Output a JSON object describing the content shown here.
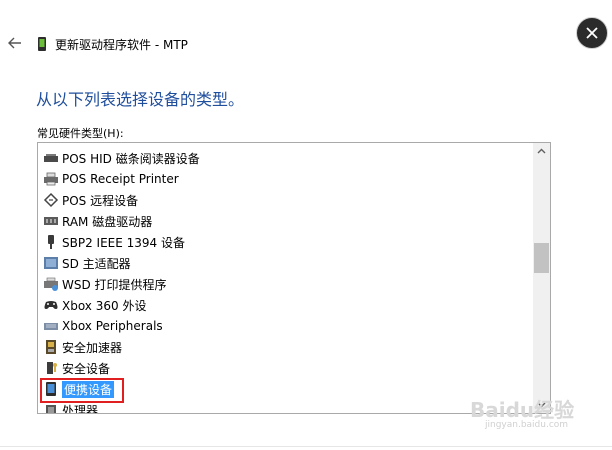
{
  "window": {
    "title": "更新驱动程序软件 - MTP"
  },
  "heading": "从以下列表选择设备的类型。",
  "list_label": "常见硬件类型(H):",
  "hardware_types": [
    {
      "label": "POS HID 磁条阅读器设备",
      "icon": "card-reader-icon"
    },
    {
      "label": "POS Receipt Printer",
      "icon": "printer-icon"
    },
    {
      "label": "POS 远程设备",
      "icon": "remote-device-icon"
    },
    {
      "label": "RAM 磁盘驱动器",
      "icon": "ram-disk-icon"
    },
    {
      "label": "SBP2 IEEE 1394 设备",
      "icon": "ieee1394-icon"
    },
    {
      "label": "SD 主适配器",
      "icon": "sd-adapter-icon"
    },
    {
      "label": "WSD 打印提供程序",
      "icon": "wsd-printer-icon"
    },
    {
      "label": "Xbox 360 外设",
      "icon": "gamepad-icon"
    },
    {
      "label": "Xbox Peripherals",
      "icon": "keyboard-icon"
    },
    {
      "label": "安全加速器",
      "icon": "security-accelerator-icon"
    },
    {
      "label": "安全设备",
      "icon": "security-device-icon"
    },
    {
      "label": "便携设备",
      "icon": "portable-device-icon"
    },
    {
      "label": "处理器",
      "icon": "processor-icon"
    }
  ],
  "selected_item": "便携设备",
  "watermark": {
    "main": "Baidu经验",
    "sub": "jingyan.baidu.com"
  }
}
